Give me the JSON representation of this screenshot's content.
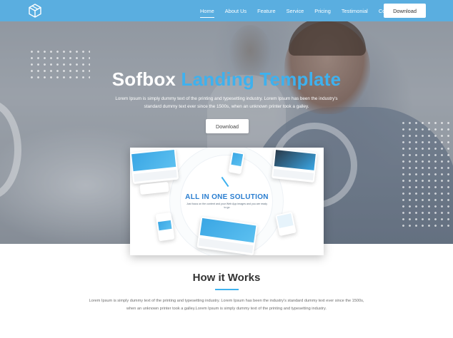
{
  "nav": {
    "logo_icon": "cube-logo-icon",
    "links": [
      {
        "label": "Home",
        "active": true
      },
      {
        "label": "About Us",
        "active": false
      },
      {
        "label": "Feature",
        "active": false
      },
      {
        "label": "Service",
        "active": false
      },
      {
        "label": "Pricing",
        "active": false
      },
      {
        "label": "Testimonial",
        "active": false
      },
      {
        "label": "Contact",
        "active": false
      }
    ],
    "download_label": "Download",
    "bar_color": "#5aaee0"
  },
  "hero": {
    "title_white": "Sofbox",
    "title_blue": "Landing Template",
    "description": "Lorem Ipsum is simply dummy text of the printing and typesetting industry. Lorem Ipsum has been the industry's standard dummy text ever since the 1500s, when an unknown printer took a galley.",
    "download_label": "Download",
    "accent_color": "#3eb1ee"
  },
  "mockup": {
    "title": "ALL IN ONE SOLUTION",
    "subtitle": "Just focus on the content and your Web App images and you are ready to go"
  },
  "how_it_works": {
    "title": "How it Works",
    "description": "Lorem Ipsum is simply dummy text of the printing and typesetting industry. Lorem Ipsum has been the industry's standard dummy text ever since the 1500s, when an unknown printer took a galley.Lorem Ipsum is simply dummy text of the printing and typesetting industry."
  }
}
